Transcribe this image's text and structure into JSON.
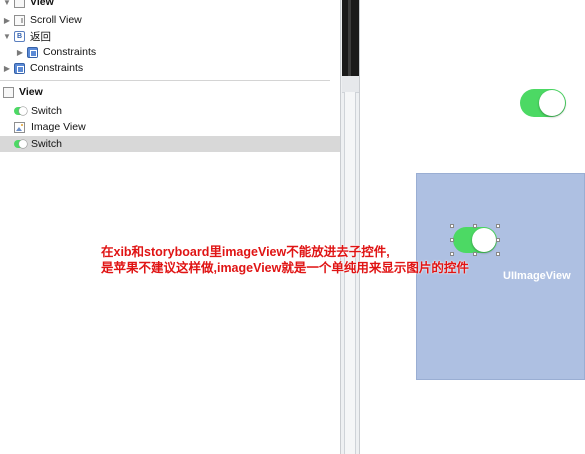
{
  "outline": {
    "header_label": "View",
    "items": [
      {
        "label": "Scroll View"
      },
      {
        "label": "返回"
      },
      {
        "label": "Constraints"
      },
      {
        "label": "Constraints"
      }
    ],
    "section_title": "View",
    "section_items": [
      {
        "label": "Switch"
      },
      {
        "label": "Image View"
      },
      {
        "label": "Switch",
        "selected": true
      }
    ]
  },
  "canvas": {
    "image_view_label": "UIImageView",
    "top_switch_state": "on",
    "inner_switch_state": "on",
    "view_background": "#aec0e2",
    "switch_color": "#4cd964"
  },
  "annotation": {
    "line1": "在xib和storyboard里imageView不能放进去子控件,",
    "line2": "是苹果不建议这样做,imageView就是一个单纯用来显示图片的控件",
    "color": "#e01414"
  },
  "icons": [
    "disclosure-triangle-icon",
    "view-icon",
    "scroll-view-icon",
    "button-icon",
    "constraints-icon",
    "switch-icon",
    "image-view-icon"
  ]
}
